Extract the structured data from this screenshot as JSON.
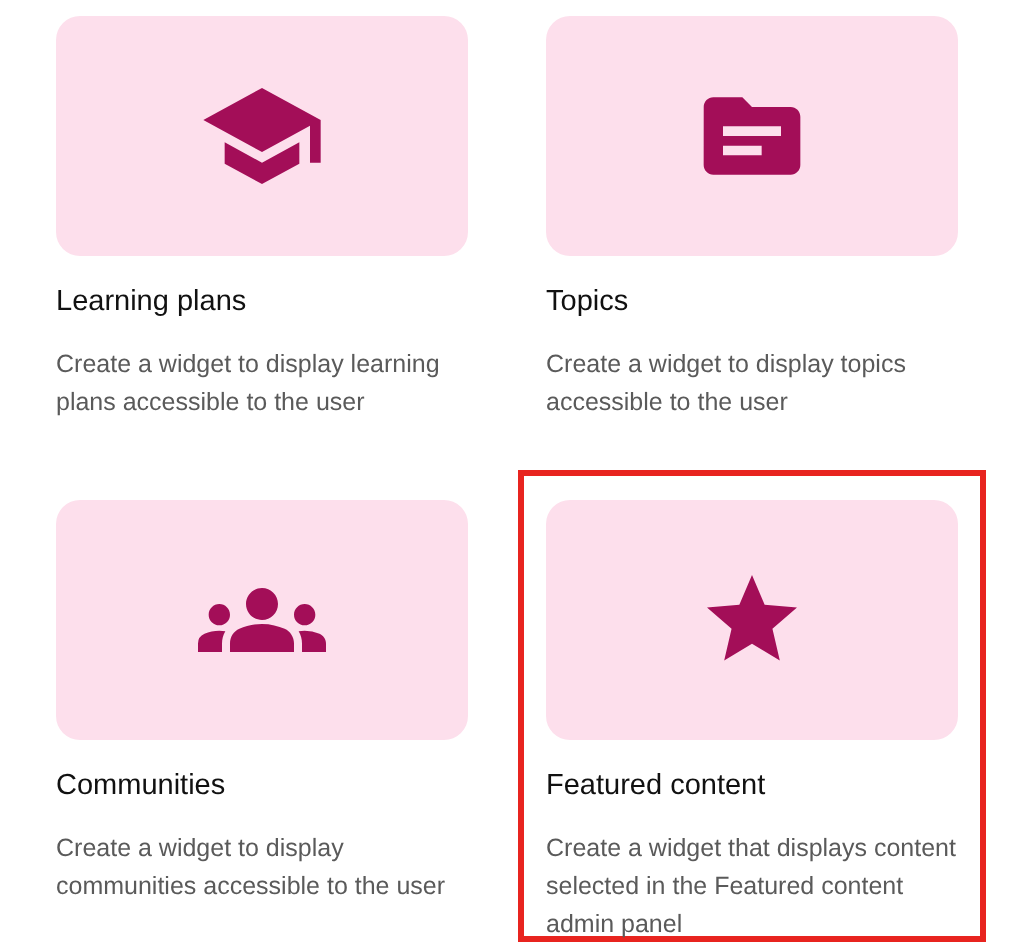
{
  "widgets": [
    {
      "kind": "learning-plans",
      "title": "Learning plans",
      "description": "Create a widget to display learning plans accessible to the user",
      "selected": false
    },
    {
      "kind": "topics",
      "title": "Topics",
      "description": "Create a widget to display topics accessible to the user",
      "selected": false
    },
    {
      "kind": "communities",
      "title": "Communities",
      "description": "Create a widget to display communities accessible to the user",
      "selected": false
    },
    {
      "kind": "featured",
      "title": "Featured content",
      "description": "Create a widget that displays content selected in the Featured content admin panel",
      "selected": true
    }
  ]
}
